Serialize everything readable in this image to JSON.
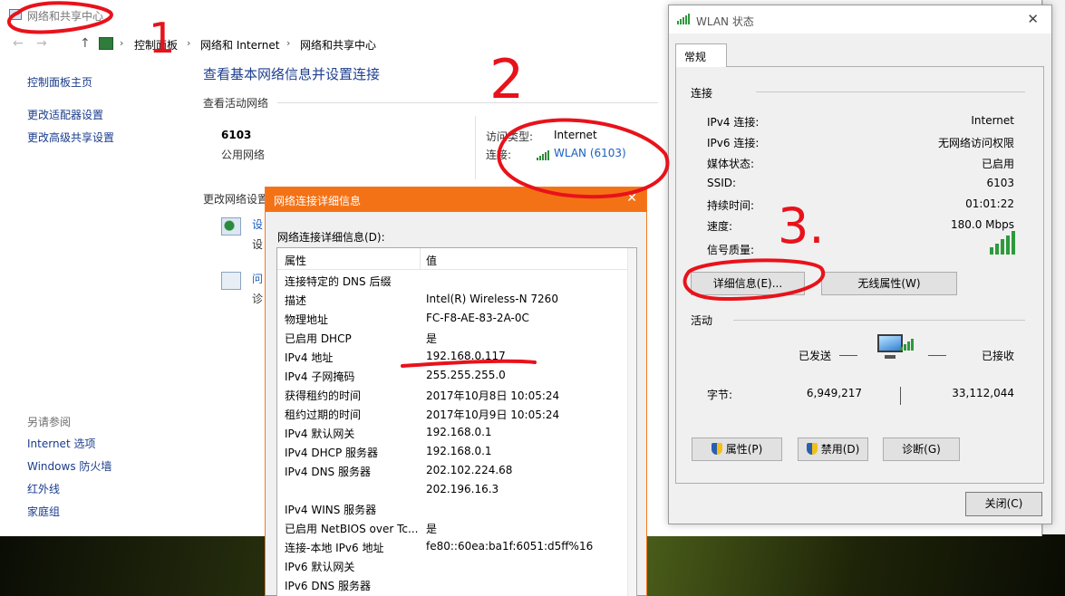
{
  "main": {
    "title": "网络和共享中心",
    "nav_back": "←",
    "nav_forward": "→",
    "nav_up": "↑",
    "breadcrumb": [
      "控制面板",
      "网络和 Internet",
      "网络和共享中心"
    ],
    "left_links": [
      "控制面板主页",
      "更改适配器设置",
      "更改高级共享设置"
    ],
    "see_also_header": "另请参阅",
    "see_also": [
      "Internet 选项",
      "Windows 防火墙",
      "红外线",
      "家庭组"
    ],
    "page_title": "查看基本网络信息并设置连接",
    "active_networks_label": "查看活动网络",
    "network_name": "6103",
    "network_type": "公用网络",
    "access_type_label": "访问类型:",
    "access_type_value": "Internet",
    "connection_label": "连接:",
    "connection_value": "WLAN (6103)",
    "change_settings_label": "更改网络设置",
    "task1_link": "设",
    "task1_sub": "设",
    "task2_link": "问",
    "task2_sub": "诊"
  },
  "details": {
    "title": "网络连接详细信息",
    "close": "✕",
    "list_label": "网络连接详细信息(D):",
    "col_property": "属性",
    "col_value": "值",
    "rows": [
      {
        "p": "连接特定的 DNS 后缀",
        "v": ""
      },
      {
        "p": "描述",
        "v": "Intel(R) Wireless-N 7260"
      },
      {
        "p": "物理地址",
        "v": "FC-F8-AE-83-2A-0C"
      },
      {
        "p": "已启用 DHCP",
        "v": "是"
      },
      {
        "p": "IPv4 地址",
        "v": "192.168.0.117"
      },
      {
        "p": "IPv4 子网掩码",
        "v": "255.255.255.0"
      },
      {
        "p": "获得租约的时间",
        "v": "2017年10月8日 10:05:24"
      },
      {
        "p": "租约过期的时间",
        "v": "2017年10月9日 10:05:24"
      },
      {
        "p": "IPv4 默认网关",
        "v": "192.168.0.1"
      },
      {
        "p": "IPv4 DHCP 服务器",
        "v": "192.168.0.1"
      },
      {
        "p": "IPv4 DNS 服务器",
        "v": "202.102.224.68"
      },
      {
        "p": "",
        "v": "202.196.16.3"
      },
      {
        "p": "IPv4 WINS 服务器",
        "v": ""
      },
      {
        "p": "已启用 NetBIOS over Tc...",
        "v": "是"
      },
      {
        "p": "连接-本地 IPv6 地址",
        "v": "fe80::60ea:ba1f:6051:d5ff%16"
      },
      {
        "p": "IPv6 默认网关",
        "v": ""
      },
      {
        "p": "IPv6 DNS 服务器",
        "v": ""
      }
    ]
  },
  "wlan": {
    "title": "WLAN 状态",
    "close": "✕",
    "tab": "常规",
    "connection_group": "连接",
    "fields": [
      {
        "label": "IPv4 连接:",
        "value": "Internet"
      },
      {
        "label": "IPv6 连接:",
        "value": "无网络访问权限"
      },
      {
        "label": "媒体状态:",
        "value": "已启用"
      },
      {
        "label": "SSID:",
        "value": "6103"
      },
      {
        "label": "持续时间:",
        "value": "01:01:22"
      },
      {
        "label": "速度:",
        "value": "180.0 Mbps"
      }
    ],
    "signal_label": "信号质量:",
    "signal_level_bars": 5,
    "details_btn": "详细信息(E)...",
    "wireless_props_btn": "无线属性(W)",
    "activity_group": "活动",
    "sent_label": "已发送",
    "received_label": "已接收",
    "bytes_label": "字节:",
    "bytes_sent": "6,949,217",
    "bytes_received": "33,112,044",
    "properties_btn": "属性(P)",
    "disable_btn": "禁用(D)",
    "diagnose_btn": "诊断(G)",
    "close_btn": "关闭(C)"
  },
  "annotations": [
    "1",
    "2",
    "3."
  ],
  "colors": {
    "accent_orange": "#f47216",
    "link_blue": "#1a5fc0",
    "signal_green": "#2e9a3c",
    "annotation_red": "#e8121b"
  }
}
